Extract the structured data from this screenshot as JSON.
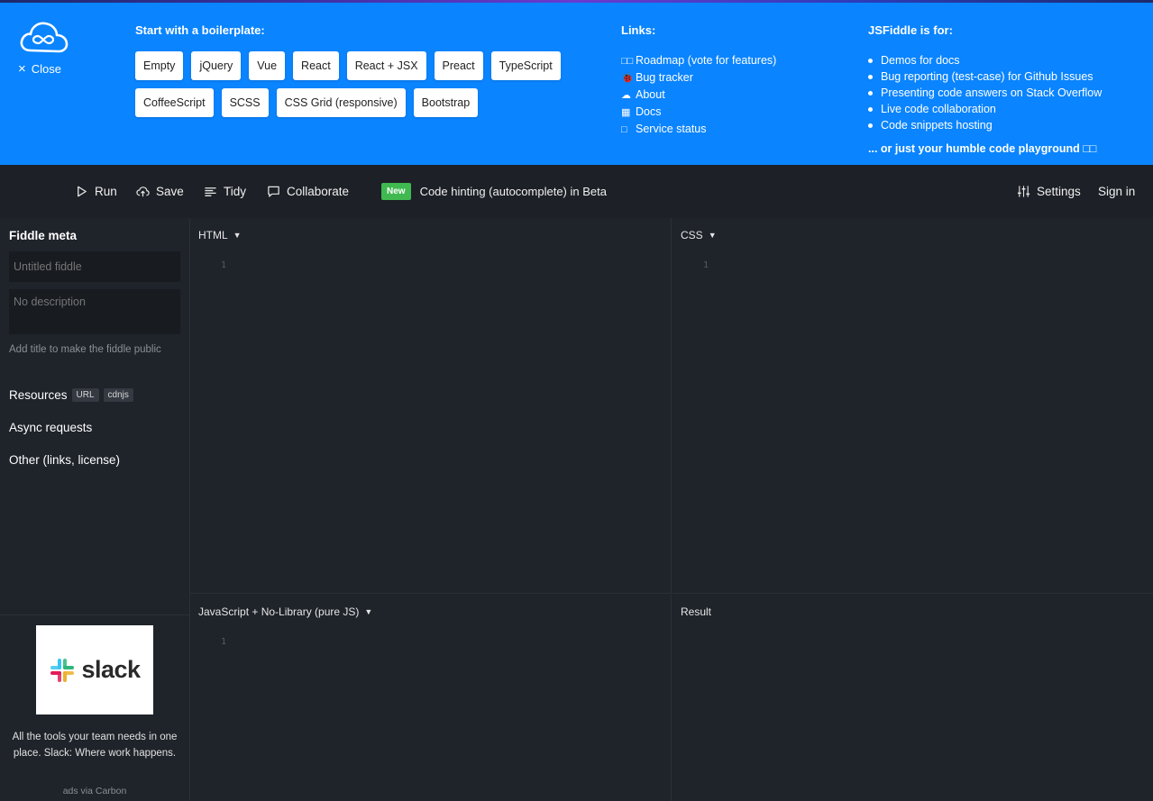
{
  "banner": {
    "close_label": "Close",
    "boilerplate_title": "Start with a boilerplate:",
    "boilerplate_rows": [
      [
        "Empty",
        "jQuery",
        "Vue",
        "React",
        "React + JSX",
        "Preact",
        "TypeScript"
      ],
      [
        "CoffeeScript",
        "SCSS",
        "CSS Grid (responsive)",
        "Bootstrap"
      ]
    ],
    "links_title": "Links:",
    "links": [
      {
        "icon": "roadmap-icon",
        "glyph": "□□",
        "label": "Roadmap (vote for features)"
      },
      {
        "icon": "bug-icon",
        "glyph": "🐞",
        "label": "Bug tracker"
      },
      {
        "icon": "cloud-icon",
        "glyph": "☁",
        "label": "About"
      },
      {
        "icon": "docs-icon",
        "glyph": "▦",
        "label": "Docs"
      },
      {
        "icon": "status-icon",
        "glyph": "□",
        "label": "Service status"
      }
    ],
    "for_title": "JSFiddle is for:",
    "for_items": [
      "Demos for docs",
      "Bug reporting (test-case) for Github Issues",
      "Presenting code answers on Stack Overflow",
      "Live code collaboration",
      "Code snippets hosting"
    ],
    "for_tagline": "... or just your humble code playground □□"
  },
  "toolbar": {
    "run": "Run",
    "save": "Save",
    "tidy": "Tidy",
    "collaborate": "Collaborate",
    "new_badge": "New",
    "hint": "Code hinting (autocomplete) in Beta",
    "settings": "Settings",
    "sign_in": "Sign in"
  },
  "sidebar": {
    "title": "Fiddle meta",
    "title_placeholder": "Untitled fiddle",
    "description_placeholder": "No description",
    "hint": "Add title to make the fiddle public",
    "resources": "Resources",
    "resource_tags": [
      "URL",
      "cdnjs"
    ],
    "async": "Async requests",
    "other": "Other (links, license)"
  },
  "ad": {
    "brand": "slack",
    "text": "All the tools your team needs in one place. Slack: Where work happens.",
    "via": "ads via Carbon"
  },
  "panes": {
    "html": "HTML",
    "css": "CSS",
    "js": "JavaScript + No-Library (pure JS)",
    "result": "Result",
    "line_number": "1"
  },
  "colors": {
    "banner": "#0a84ff",
    "toolbar": "#1d2026",
    "editor_bg": "#1f232a",
    "new_badge": "#3fb950"
  }
}
